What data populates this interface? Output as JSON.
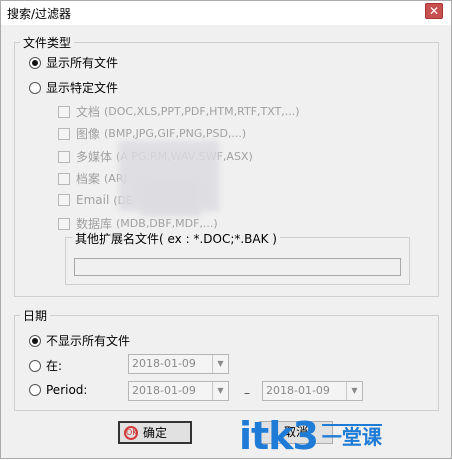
{
  "window": {
    "title": "搜索/过滤器",
    "close_glyph": "✕"
  },
  "file_types": {
    "legend": "文件类型",
    "show_all_label": "显示所有文件",
    "show_all_checked": true,
    "show_specific_label": "显示特定文件",
    "show_specific_checked": false,
    "items": [
      {
        "name": "文档",
        "ext": "(DOC,XLS,PPT,PDF,HTM,RTF,TXT,...)"
      },
      {
        "name": "图像",
        "ext": "(BMP,JPG,GIF,PNG,PSD,...)"
      },
      {
        "name": "多媒体",
        "ext": "(A                  PG,RM,WAV,SWF,ASX)"
      },
      {
        "name": "档案",
        "ext": "(ARJ"
      },
      {
        "name": "Email",
        "ext": "(DE"
      },
      {
        "name": "数据库",
        "ext": "(MDB,DBF,MDF,...)"
      }
    ],
    "other_ext_legend": "其他扩展名文件( ex : *.DOC;*.BAK )",
    "other_ext_value": ""
  },
  "date": {
    "legend": "日期",
    "no_date_label": "不显示所有文件",
    "no_date_checked": true,
    "on_label": "在:",
    "on_value": "2018-01-09",
    "period_label": "Period:",
    "period_from": "2018-01-09",
    "period_to": "2018-01-09",
    "period_dash": "–"
  },
  "buttons": {
    "ok": "确定",
    "ok_icon": "OK",
    "cancel": "取消"
  },
  "watermark": {
    "main": "itk3",
    "sub": "一堂课"
  }
}
